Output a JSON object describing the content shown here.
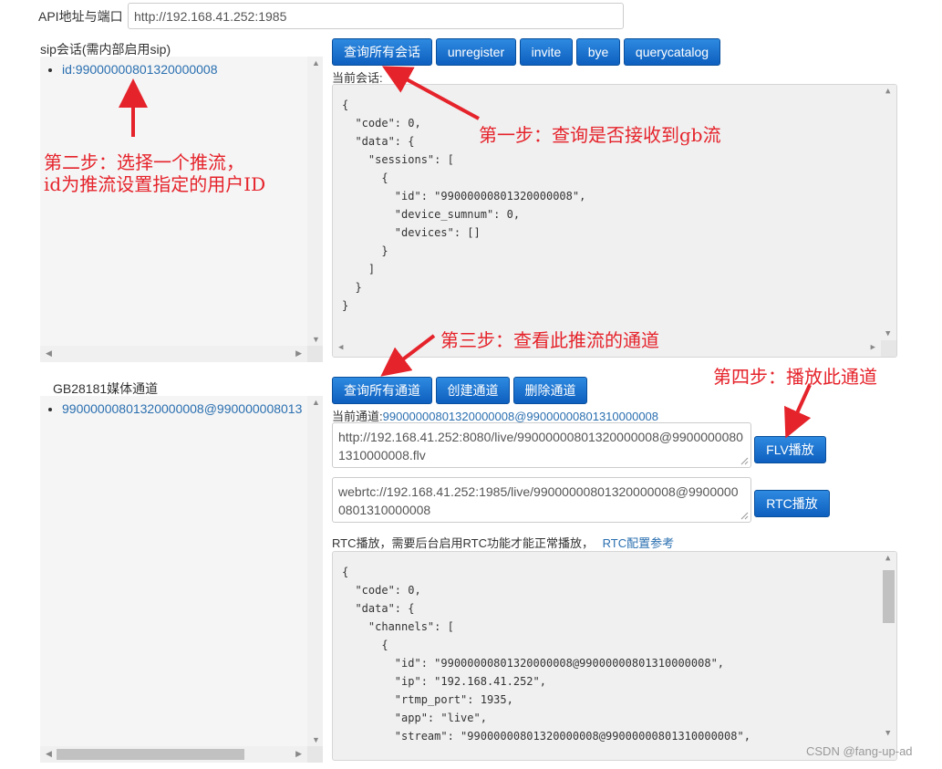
{
  "api": {
    "label": "API地址与端口",
    "value": "http://192.168.41.252:1985"
  },
  "sip": {
    "label": "sip会话(需内部启用sip)",
    "items": [
      {
        "label": "id:99000000801320000008"
      }
    ],
    "buttons": {
      "query_all": "查询所有会话",
      "unregister": "unregister",
      "invite": "invite",
      "bye": "bye",
      "querycatalog": "querycatalog"
    },
    "current_label": "当前会话:",
    "json": "{\n  \"code\": 0,\n  \"data\": {\n    \"sessions\": [\n      {\n        \"id\": \"99000000801320000008\",\n        \"device_sumnum\": 0,\n        \"devices\": []\n      }\n    ]\n  }\n}"
  },
  "gb": {
    "label": "GB28181媒体通道",
    "items": [
      {
        "label": "99000000801320000008@990000008013"
      }
    ],
    "buttons": {
      "query_all": "查询所有通道",
      "create": "创建通道",
      "delete": "删除通道"
    },
    "current_label": "当前通道:",
    "current_value": "99000000801320000008@99000000801310000008",
    "flv_url": "http://192.168.41.252:8080/live/99000000801320000008@99000000801310000008.flv",
    "flv_button": "FLV播放",
    "rtc_url": "webrtc://192.168.41.252:1985/live/99000000801320000008@99000000801310000008",
    "rtc_button": "RTC播放",
    "rtc_note": "RTC播放，需要后台启用RTC功能才能正常播放，",
    "rtc_link": "RTC配置参考",
    "json": "{\n  \"code\": 0,\n  \"data\": {\n    \"channels\": [\n      {\n        \"id\": \"99000000801320000008@99000000801310000008\",\n        \"ip\": \"192.168.41.252\",\n        \"rtmp_port\": 1935,\n        \"app\": \"live\",\n        \"stream\": \"99000000801320000008@99000000801310000008\","
  },
  "annotations": {
    "step1": "第一步：查询是否接收到gb流",
    "step2_line1": "第二步：选择一个推流，",
    "step2_line2": "id为推流设置指定的用户ID",
    "step3": "第三步：查看此推流的通道",
    "step4": "第四步：播放此通道"
  },
  "watermark": "CSDN @fang-up-ad",
  "colors": {
    "button": "#0e5fbf",
    "annotation": "#e5232b",
    "link": "#2a6fb0"
  }
}
